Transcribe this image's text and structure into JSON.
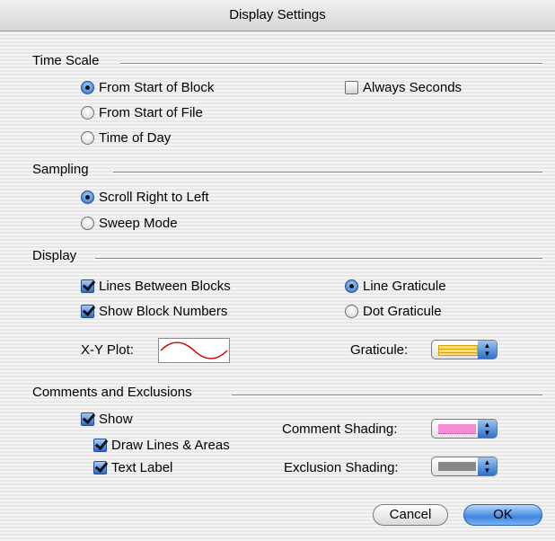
{
  "window": {
    "title": "Display Settings"
  },
  "time_scale": {
    "label": "Time Scale",
    "options": [
      "From Start of Block",
      "From Start of File",
      "Time of Day"
    ],
    "selected": "From Start of Block",
    "always_seconds": {
      "label": "Always Seconds",
      "checked": false
    }
  },
  "sampling": {
    "label": "Sampling",
    "options": [
      "Scroll Right to Left",
      "Sweep Mode"
    ],
    "selected": "Scroll Right to Left"
  },
  "display": {
    "label": "Display",
    "lines_between_blocks": {
      "label": "Lines Between Blocks",
      "checked": true
    },
    "show_block_numbers": {
      "label": "Show Block Numbers",
      "checked": true
    },
    "graticule_options": [
      "Line Graticule",
      "Dot Graticule"
    ],
    "graticule_selected": "Line Graticule",
    "xy_plot_label": "X-Y Plot:",
    "graticule_label": "Graticule:",
    "graticule_color": "#f2c94c",
    "xy_plot_line_color": "#cc0000"
  },
  "comments": {
    "label": "Comments and Exclusions",
    "show": {
      "label": "Show",
      "checked": true
    },
    "draw_lines_areas": {
      "label": "Draw Lines & Areas",
      "checked": true
    },
    "text_label": {
      "label": "Text Label",
      "checked": true
    },
    "comment_shading_label": "Comment Shading:",
    "comment_shading_color": "#f58ad6",
    "exclusion_shading_label": "Exclusion Shading:",
    "exclusion_shading_color": "#888888"
  },
  "buttons": {
    "cancel": "Cancel",
    "ok": "OK"
  }
}
